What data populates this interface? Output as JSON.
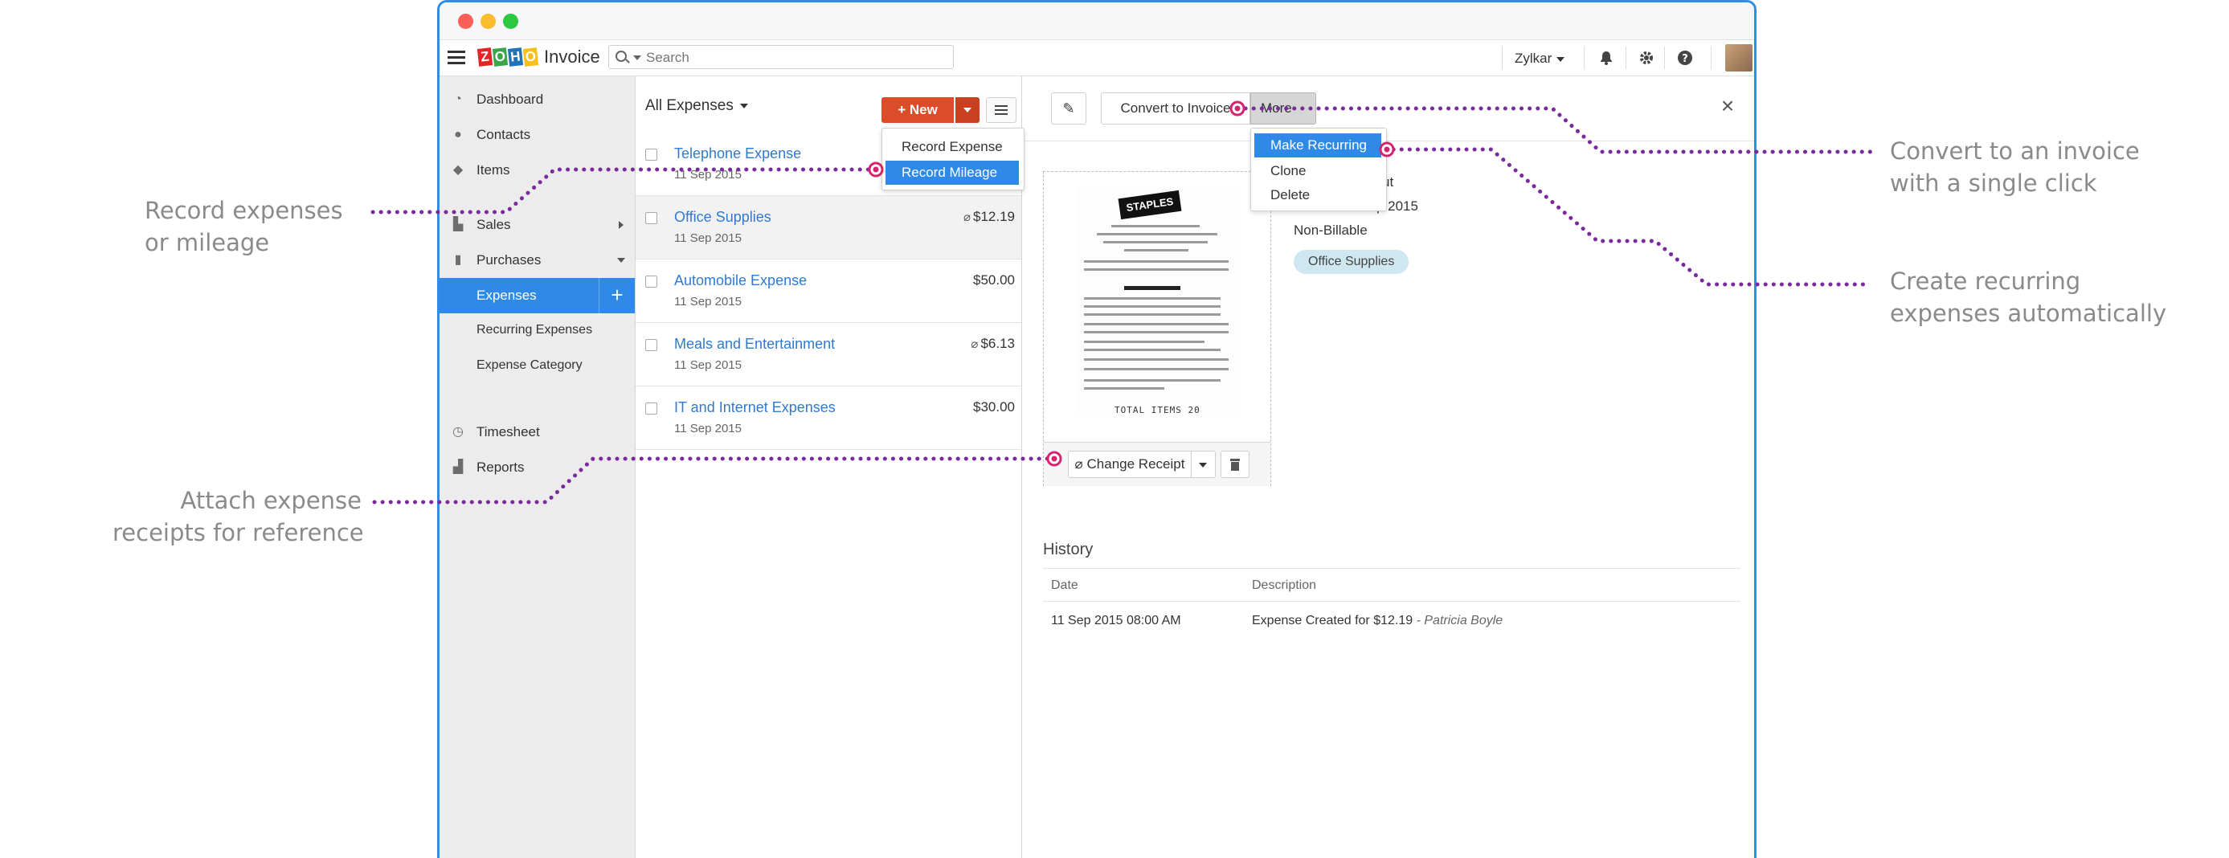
{
  "callouts": {
    "left_top": [
      "Record expenses",
      "or mileage"
    ],
    "left_bottom": [
      "Attach expense",
      "receipts for reference"
    ],
    "right_top": [
      "Convert to an invoice",
      "with a single click"
    ],
    "right_bottom": [
      "Create recurring",
      "expenses automatically"
    ]
  },
  "app": {
    "logo_letters": [
      "Z",
      "O",
      "H",
      "O"
    ],
    "logo_colors": [
      "#e42527",
      "#3aa64a",
      "#2173b9",
      "#f5c019"
    ],
    "logo_text": "Invoice",
    "search_placeholder": "Search",
    "org_name": "Zylkar",
    "header_icons": [
      "bell-icon",
      "gear-icon",
      "help-icon"
    ]
  },
  "sidebar": {
    "items": [
      {
        "label": "Dashboard",
        "icon": "dashboard-icon"
      },
      {
        "label": "Contacts",
        "icon": "contacts-icon"
      },
      {
        "label": "Items",
        "icon": "items-icon"
      },
      {
        "label": "Sales",
        "icon": "cart-icon"
      },
      {
        "label": "Purchases",
        "icon": "bag-icon"
      },
      {
        "label": "Expenses"
      },
      {
        "label": "Recurring Expenses"
      },
      {
        "label": "Expense Category"
      },
      {
        "label": "Timesheet",
        "icon": "timesheet-icon"
      },
      {
        "label": "Reports",
        "icon": "reports-icon"
      }
    ]
  },
  "list": {
    "title": "All Expenses",
    "new_label": "+ New",
    "new_menu": [
      "Record Expense",
      "Record Mileage"
    ],
    "rows": [
      {
        "name": "Telephone Expense",
        "date": "11 Sep 2015",
        "amount": ""
      },
      {
        "name": "Office Supplies",
        "date": "11 Sep 2015",
        "amount": "$12.19",
        "attachment": true
      },
      {
        "name": "Automobile Expense",
        "date": "11 Sep 2015",
        "amount": "$50.00"
      },
      {
        "name": "Meals and Entertainment",
        "date": "11 Sep 2015",
        "amount": "$6.13",
        "attachment": true
      },
      {
        "name": "IT and Internet Expenses",
        "date": "11 Sep 2015",
        "amount": "$30.00"
      }
    ]
  },
  "detail": {
    "convert_label": "Convert to Invoice",
    "more_label": "More",
    "more_menu": [
      "Make Recurring",
      "Clone",
      "Delete"
    ],
    "partial_status": "ut",
    "partial_date": "1 Sep 2015",
    "billable": "Non-Billable",
    "category_tag": "Office Supplies",
    "receipt_logo": "STAPLES",
    "receipt_total": "TOTAL ITEMS  20",
    "change_receipt_label": "Change Receipt",
    "history_title": "History",
    "history_columns": [
      "Date",
      "Description"
    ],
    "history_rows": [
      {
        "date": "11 Sep 2015 08:00 AM",
        "description": "Expense Created for $12.19",
        "by": "- Patricia Boyle"
      }
    ]
  },
  "colors": {
    "accent": "#2e8ae6",
    "new_button": "#dc4c28",
    "callout_dots": "#7b2a9e",
    "callout_marker": "#d4246f"
  }
}
